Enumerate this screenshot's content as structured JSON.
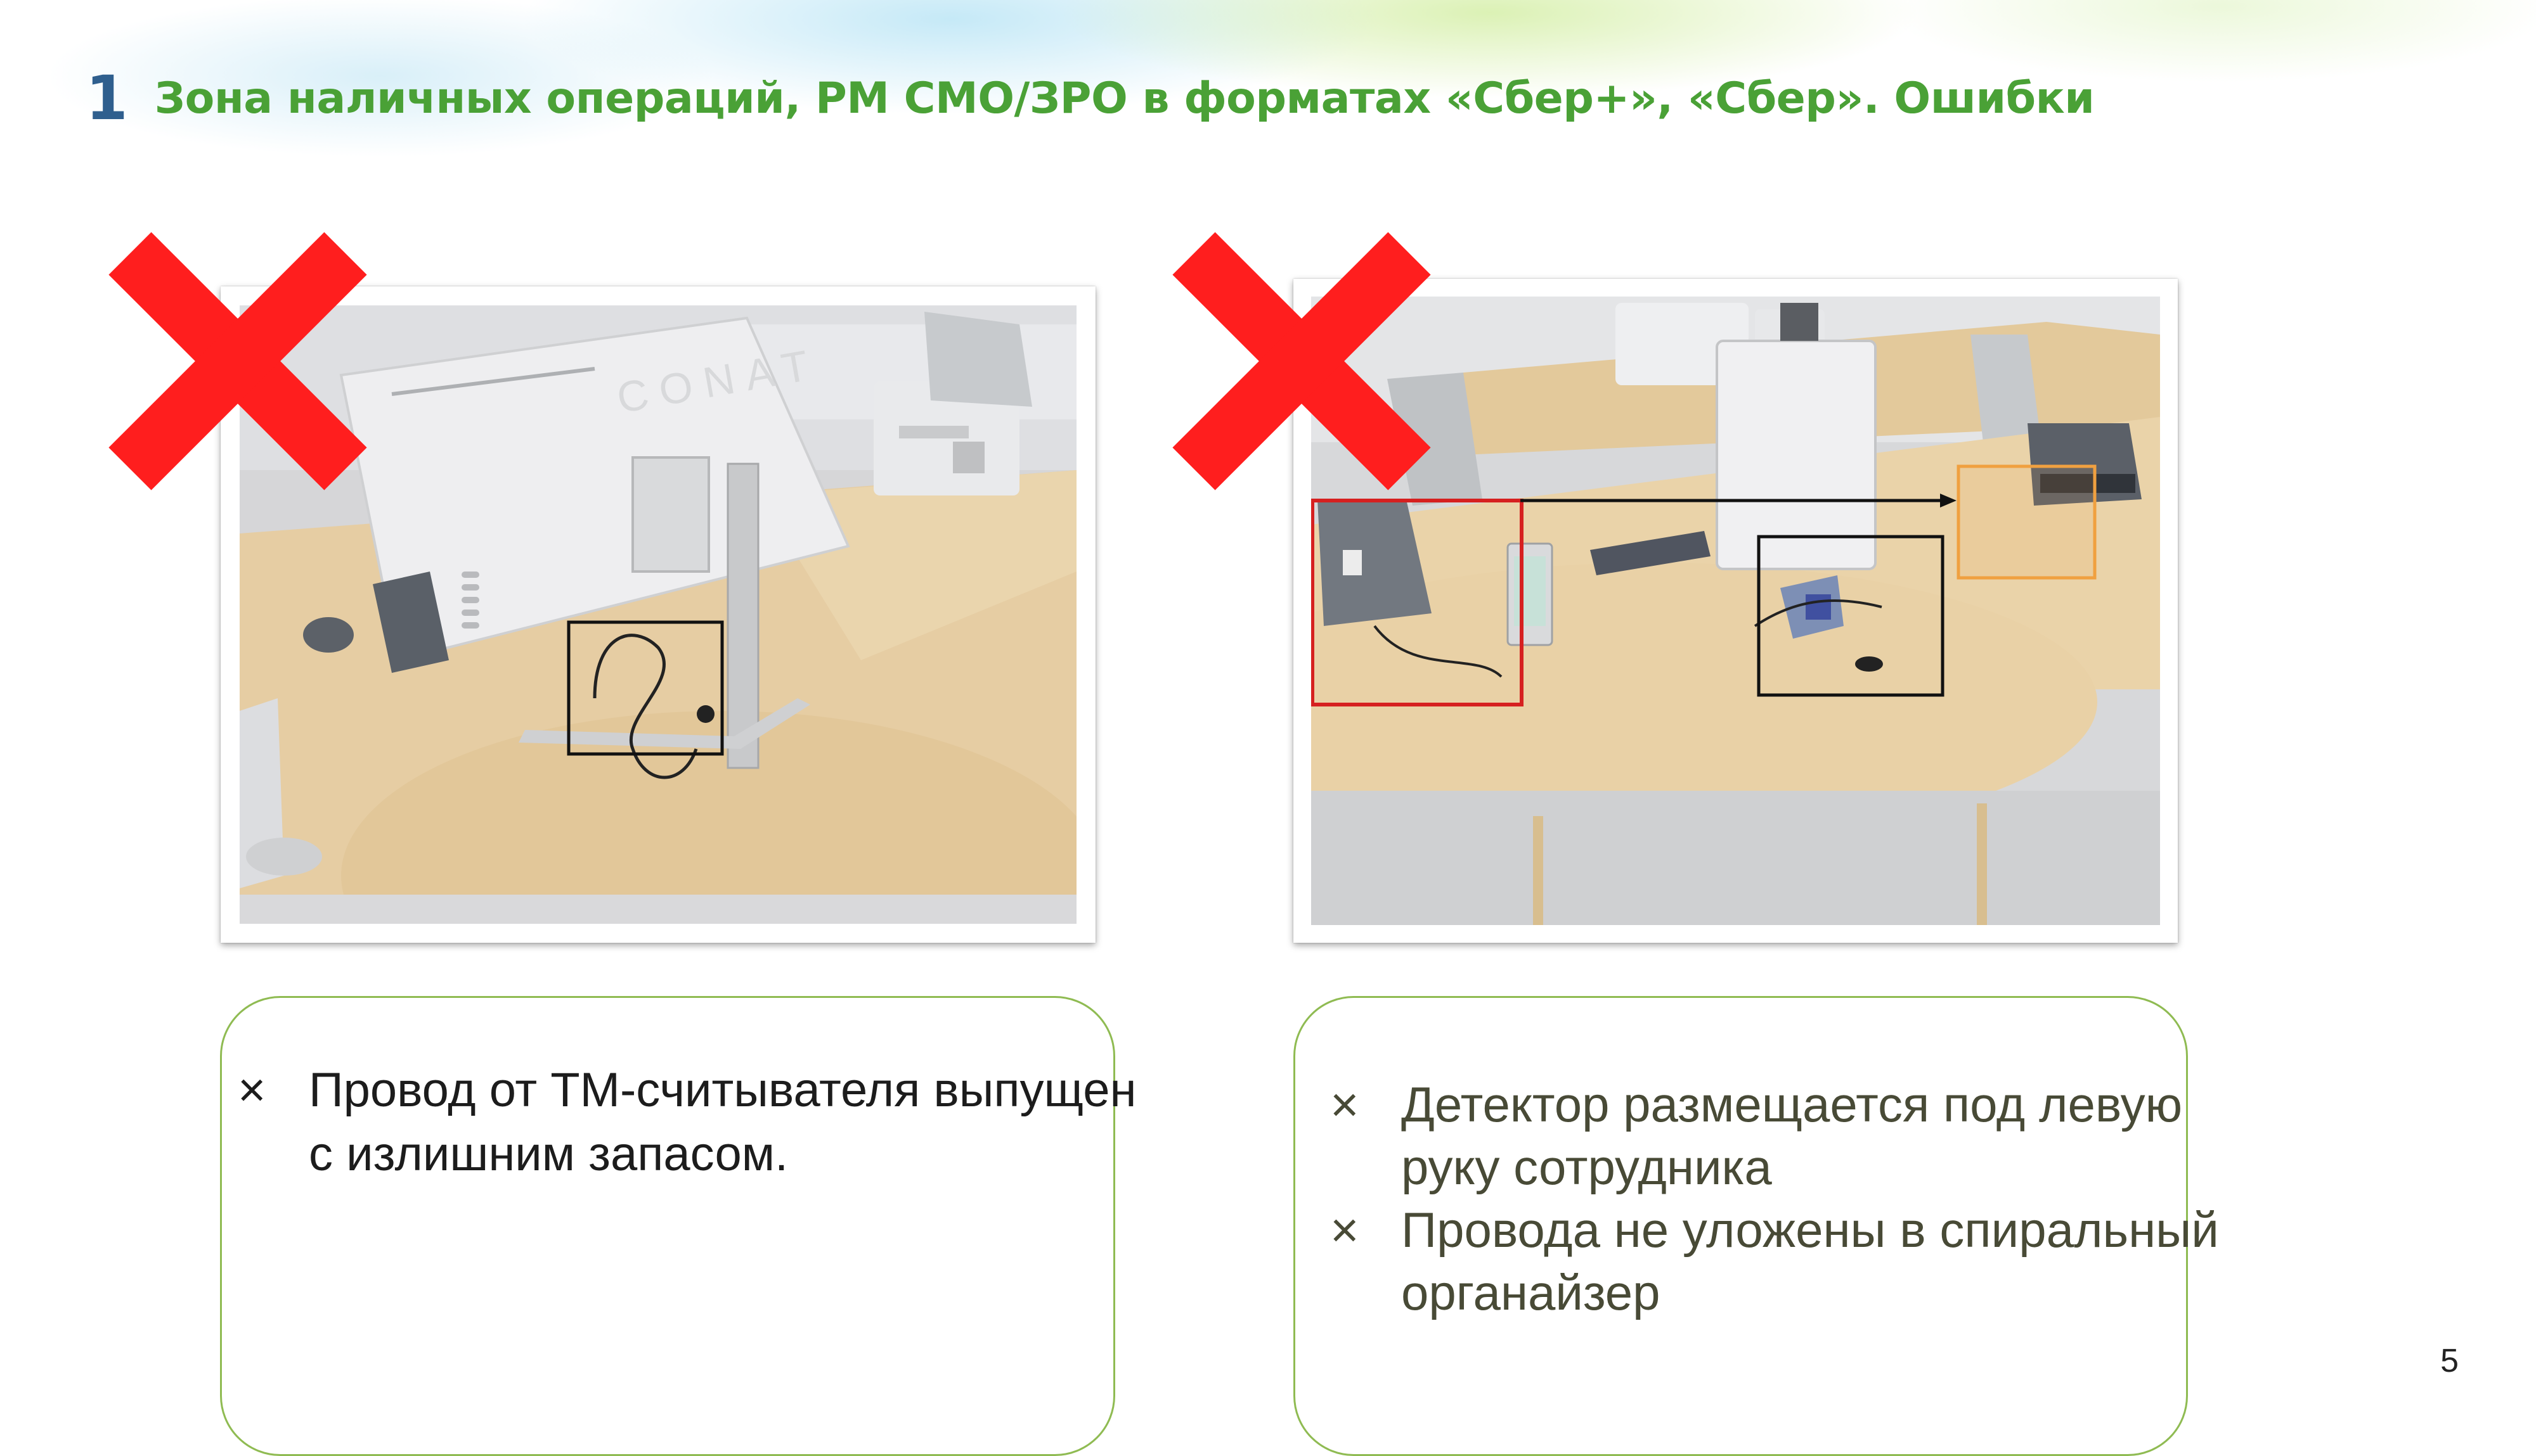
{
  "header": {
    "number": "1",
    "title": "Зона наличных операций, РМ СМО/ЗРО в форматах «Сбер+», «Сбер». Ошибки"
  },
  "photos": [
    {
      "label": "CONAT",
      "mark_icon": "red-cross-icon"
    },
    {
      "mark_icon": "red-cross-icon"
    }
  ],
  "cards": [
    {
      "bullet_symbol": "×",
      "bullets": [
        "Провод от ТМ-считывателя выпущен с излишним запасом."
      ]
    },
    {
      "bullet_symbol": "×",
      "bullets": [
        "Детектор размещается под левую руку сотрудника",
        "Провода не уложены в спиральный органайзер"
      ]
    }
  ],
  "page_number": "5",
  "colors": {
    "title_number": "#2f5f8e",
    "title_text": "#4aa136",
    "card_border": "#8fbb52",
    "cross": "#ff1e1e",
    "highlight_red": "#d62020",
    "highlight_orange": "#f0a040",
    "highlight_black": "#111111"
  }
}
